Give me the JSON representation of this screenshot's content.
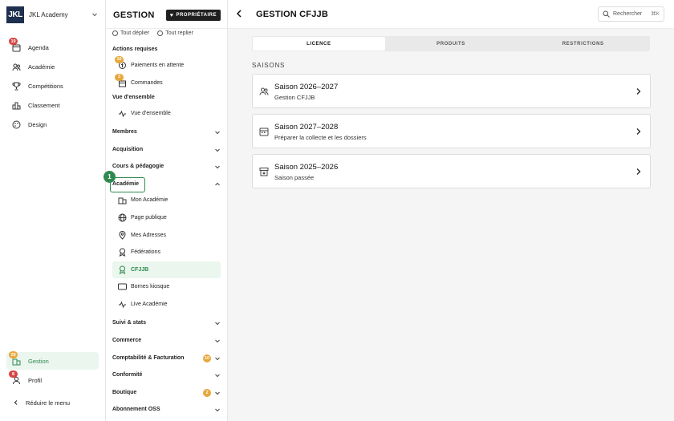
{
  "sidebar": {
    "brand_logo": "JKL",
    "brand_name": "JKL Academy",
    "items": [
      {
        "label": "Agenda",
        "icon": "calendar-icon",
        "badge": "19"
      },
      {
        "label": "Académie",
        "icon": "users-icon"
      },
      {
        "label": "Compétitions",
        "icon": "trophy-icon"
      },
      {
        "label": "Classement",
        "icon": "podium-icon"
      },
      {
        "label": "Design",
        "icon": "palette-icon"
      }
    ],
    "bottom_items": [
      {
        "label": "Gestion",
        "icon": "building-icon",
        "badge": "29"
      },
      {
        "label": "Profil",
        "icon": "user-icon",
        "badge": "8"
      }
    ],
    "collapse_label": "Réduire le menu"
  },
  "gestion": {
    "title": "GESTION",
    "owner_badge": "PROPRIÉTAIRE",
    "expand_all": "Tout déplier",
    "collapse_all": "Tout replier",
    "actions_label": "Actions requises",
    "actions": [
      {
        "label": "Paiements en attente",
        "badge": "10"
      },
      {
        "label": "Commandes",
        "badge": "3"
      }
    ],
    "overview_label": "Vue d'ensemble",
    "overview_item": "Vue d'ensemble",
    "groups_top": [
      "Membres",
      "Acquisition",
      "Cours & pédagogie"
    ],
    "academie_label": "Académie",
    "academie_items": [
      "Mon Académie",
      "Page publique",
      "Mes Adresses",
      "Fédérations",
      "CFJJB",
      "Bornes kiosque",
      "Live Académie"
    ],
    "groups_bottom": [
      {
        "label": "Suivi & stats"
      },
      {
        "label": "Commerce"
      },
      {
        "label": "Comptabilité & Facturation",
        "badge": "10"
      },
      {
        "label": "Conformité"
      },
      {
        "label": "Boutique",
        "badge": "2"
      },
      {
        "label": "Abonnement OSS"
      }
    ],
    "step_number": "1"
  },
  "main": {
    "title": "GESTION CFJJB",
    "search_placeholder": "Rechercher",
    "search_shortcut": "⌘K",
    "tabs": [
      "LICENCE",
      "PRODUITS",
      "RESTRICTIONS"
    ],
    "active_tab": "LICENCE",
    "section_label": "SAISONS",
    "seasons": [
      {
        "title": "Saison 2026–2027",
        "subtitle": "Gestion CFJJB",
        "icon": "users-icon"
      },
      {
        "title": "Saison 2027–2028",
        "subtitle": "Préparer la collecte et les dossiers",
        "icon": "calendar-icon"
      },
      {
        "title": "Saison 2025–2026",
        "subtitle": "Saison passée",
        "icon": "archive-icon"
      }
    ]
  },
  "colors": {
    "accent": "#2f8a4f",
    "active_bg": "#eaf6ee",
    "badge_red": "#d64545",
    "badge_orange": "#e8a73a",
    "brand": "#1e2f4f"
  }
}
